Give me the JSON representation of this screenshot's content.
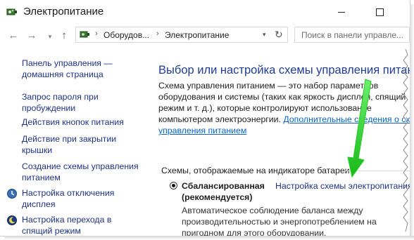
{
  "window": {
    "title": "Электропитание"
  },
  "nav": {
    "breadcrumb": [
      "Оборудов...",
      "Электропитание"
    ],
    "search_placeholder": "Поиск в панели управле..."
  },
  "sidebar": {
    "items": [
      {
        "label_line1": "Панель управления —",
        "label_line2": "домашняя страница"
      },
      {
        "label_line1": "Запрос пароля при",
        "label_line2": "пробуждении"
      },
      {
        "label_line1": "Действия кнопок питания"
      },
      {
        "label_line1": "Действие при закрытии",
        "label_line2": "крышки"
      },
      {
        "label_line1": "Создание схемы управления",
        "label_line2": "питанием"
      },
      {
        "label_line1": "Настройка отключения",
        "label_line2": "дисплея"
      },
      {
        "label_line1": "Настройка перехода в",
        "label_line2": "спящий режим"
      }
    ]
  },
  "main": {
    "title": "Выбор или настройка схемы управления питанием",
    "description_lines": [
      "Схема управления питанием — это набор параметров",
      "оборудования и системы (таких как яркость дисплея, спящий",
      "режим и т. д.), которые контролируют использование",
      "компьютером электроэнергии."
    ],
    "description_link_1": "Дополнительные сведения о схемах",
    "description_link_2": "управления питанием",
    "group_header": "Схемы, отображаемые на индикаторе батареи",
    "plan": {
      "name_line1": "Сбалансированная",
      "name_line2": "(рекомендуется)",
      "selected": true,
      "settings_link": "Настройка схемы электропитания",
      "description_lines": [
        "Автоматическое соблюдение баланса между",
        "производительностью и энергопотреблением на",
        "пригодном для этого оборудовании."
      ]
    }
  },
  "annotation": {
    "arrow_color": "#22cc22"
  }
}
